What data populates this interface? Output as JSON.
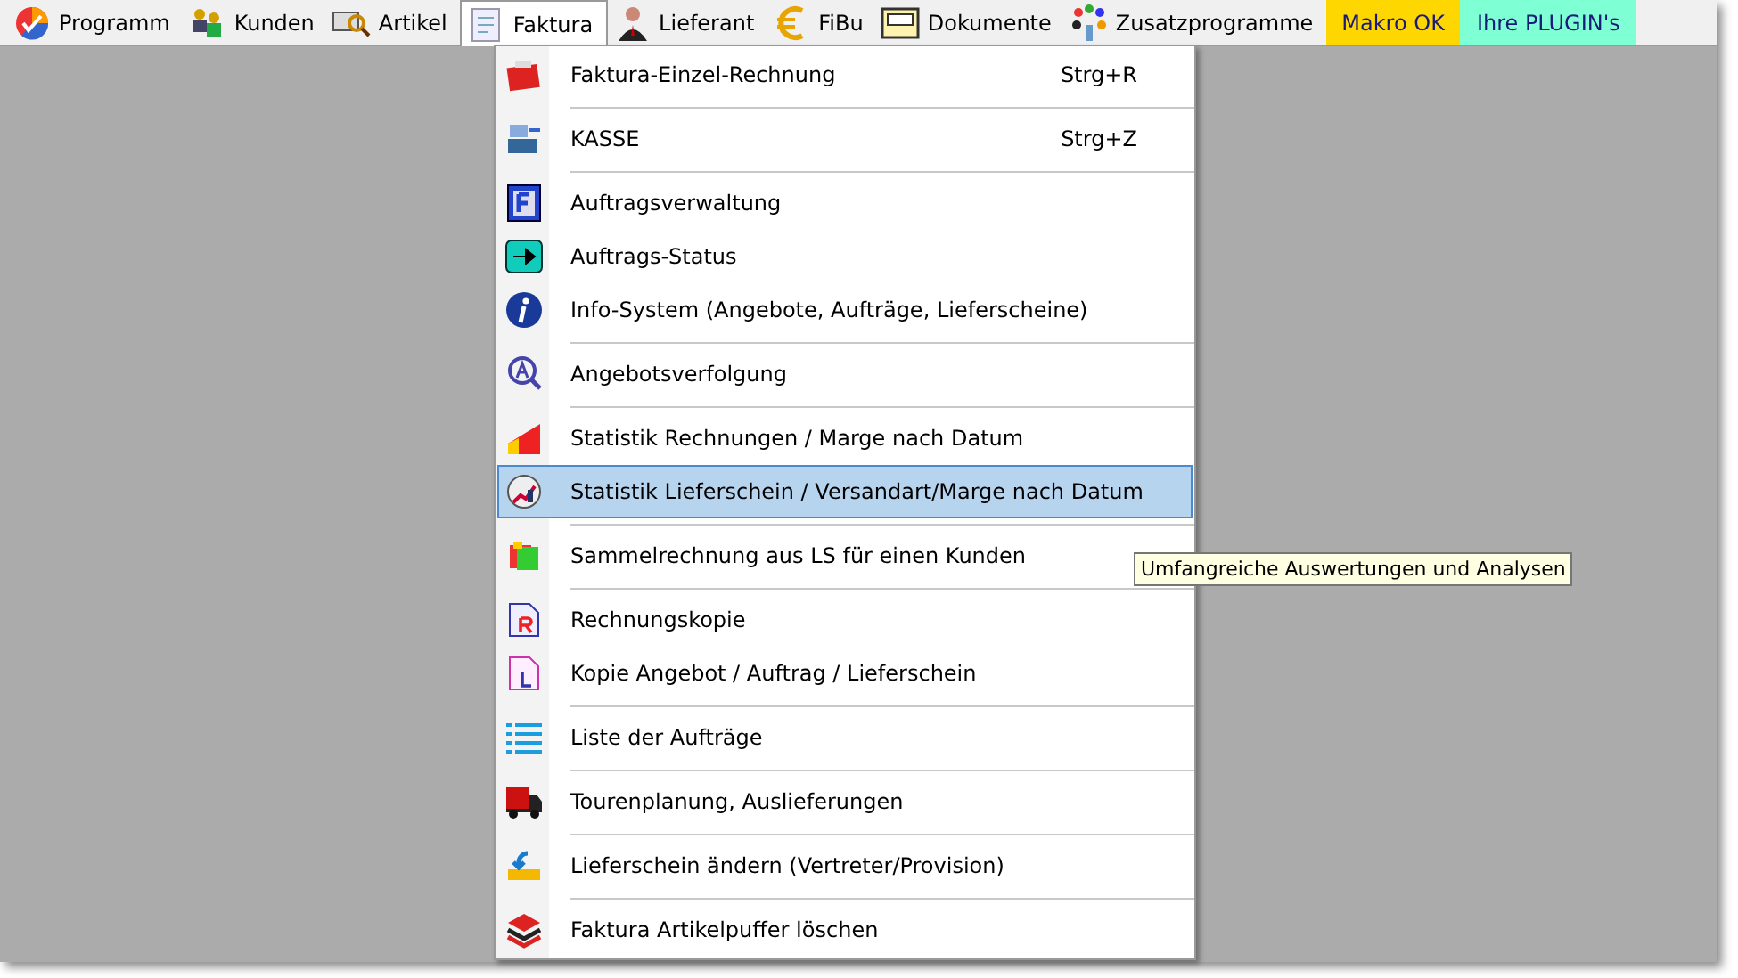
{
  "menu_bar": [
    {
      "label": "Programm",
      "selected": false
    },
    {
      "label": "Kunden",
      "selected": false
    },
    {
      "label": "Artikel",
      "selected": false
    },
    {
      "label": "Faktura",
      "selected": true
    },
    {
      "label": "Lieferant",
      "selected": false
    },
    {
      "label": "FiBu",
      "selected": false
    },
    {
      "label": "Dokumente",
      "selected": false
    },
    {
      "label": "Zusatzprogramme",
      "selected": false
    },
    {
      "label": "Makro OK",
      "selected": false,
      "color": "#ffd700"
    },
    {
      "label": "Ihre PLUGIN's",
      "selected": false,
      "color": "#7fffd4"
    }
  ],
  "dropdown": [
    {
      "kind": "item",
      "label": "Faktura-Einzel-Rechnung",
      "shortcut": "Strg+R",
      "selected": false
    },
    {
      "kind": "separator"
    },
    {
      "kind": "item",
      "label": "KASSE",
      "shortcut": "Strg+Z",
      "selected": false
    },
    {
      "kind": "separator"
    },
    {
      "kind": "item",
      "label": "Auftragsverwaltung",
      "selected": false
    },
    {
      "kind": "item",
      "label": "Auftrags-Status",
      "selected": false
    },
    {
      "kind": "item",
      "label": "Info-System (Angebote, Aufträge, Lieferscheine)",
      "selected": false
    },
    {
      "kind": "separator"
    },
    {
      "kind": "item",
      "label": "Angebotsverfolgung",
      "selected": false
    },
    {
      "kind": "separator"
    },
    {
      "kind": "item",
      "label": "Statistik Rechnungen / Marge nach Datum",
      "selected": false
    },
    {
      "kind": "item",
      "label": "Statistik Lieferschein / Versandart/Marge nach Datum",
      "selected": true
    },
    {
      "kind": "separator"
    },
    {
      "kind": "item",
      "label": "Sammelrechnung aus LS für einen Kunden",
      "selected": false
    },
    {
      "kind": "separator"
    },
    {
      "kind": "item",
      "label": "Rechnungskopie",
      "selected": false
    },
    {
      "kind": "item",
      "label": "Kopie Angebot / Auftrag / Lieferschein",
      "selected": false
    },
    {
      "kind": "separator"
    },
    {
      "kind": "item",
      "label": "Liste der Aufträge",
      "selected": false
    },
    {
      "kind": "separator"
    },
    {
      "kind": "item",
      "label": "Tourenplanung, Auslieferungen",
      "selected": false
    },
    {
      "kind": "separator"
    },
    {
      "kind": "item",
      "label": "Lieferschein ändern (Vertreter/Provision)",
      "selected": false
    },
    {
      "kind": "separator"
    },
    {
      "kind": "item",
      "label": "Faktura Artikelpuffer löschen",
      "selected": false
    }
  ],
  "tooltip": {
    "text": "Umfangreiche Auswertungen und Analysen"
  }
}
